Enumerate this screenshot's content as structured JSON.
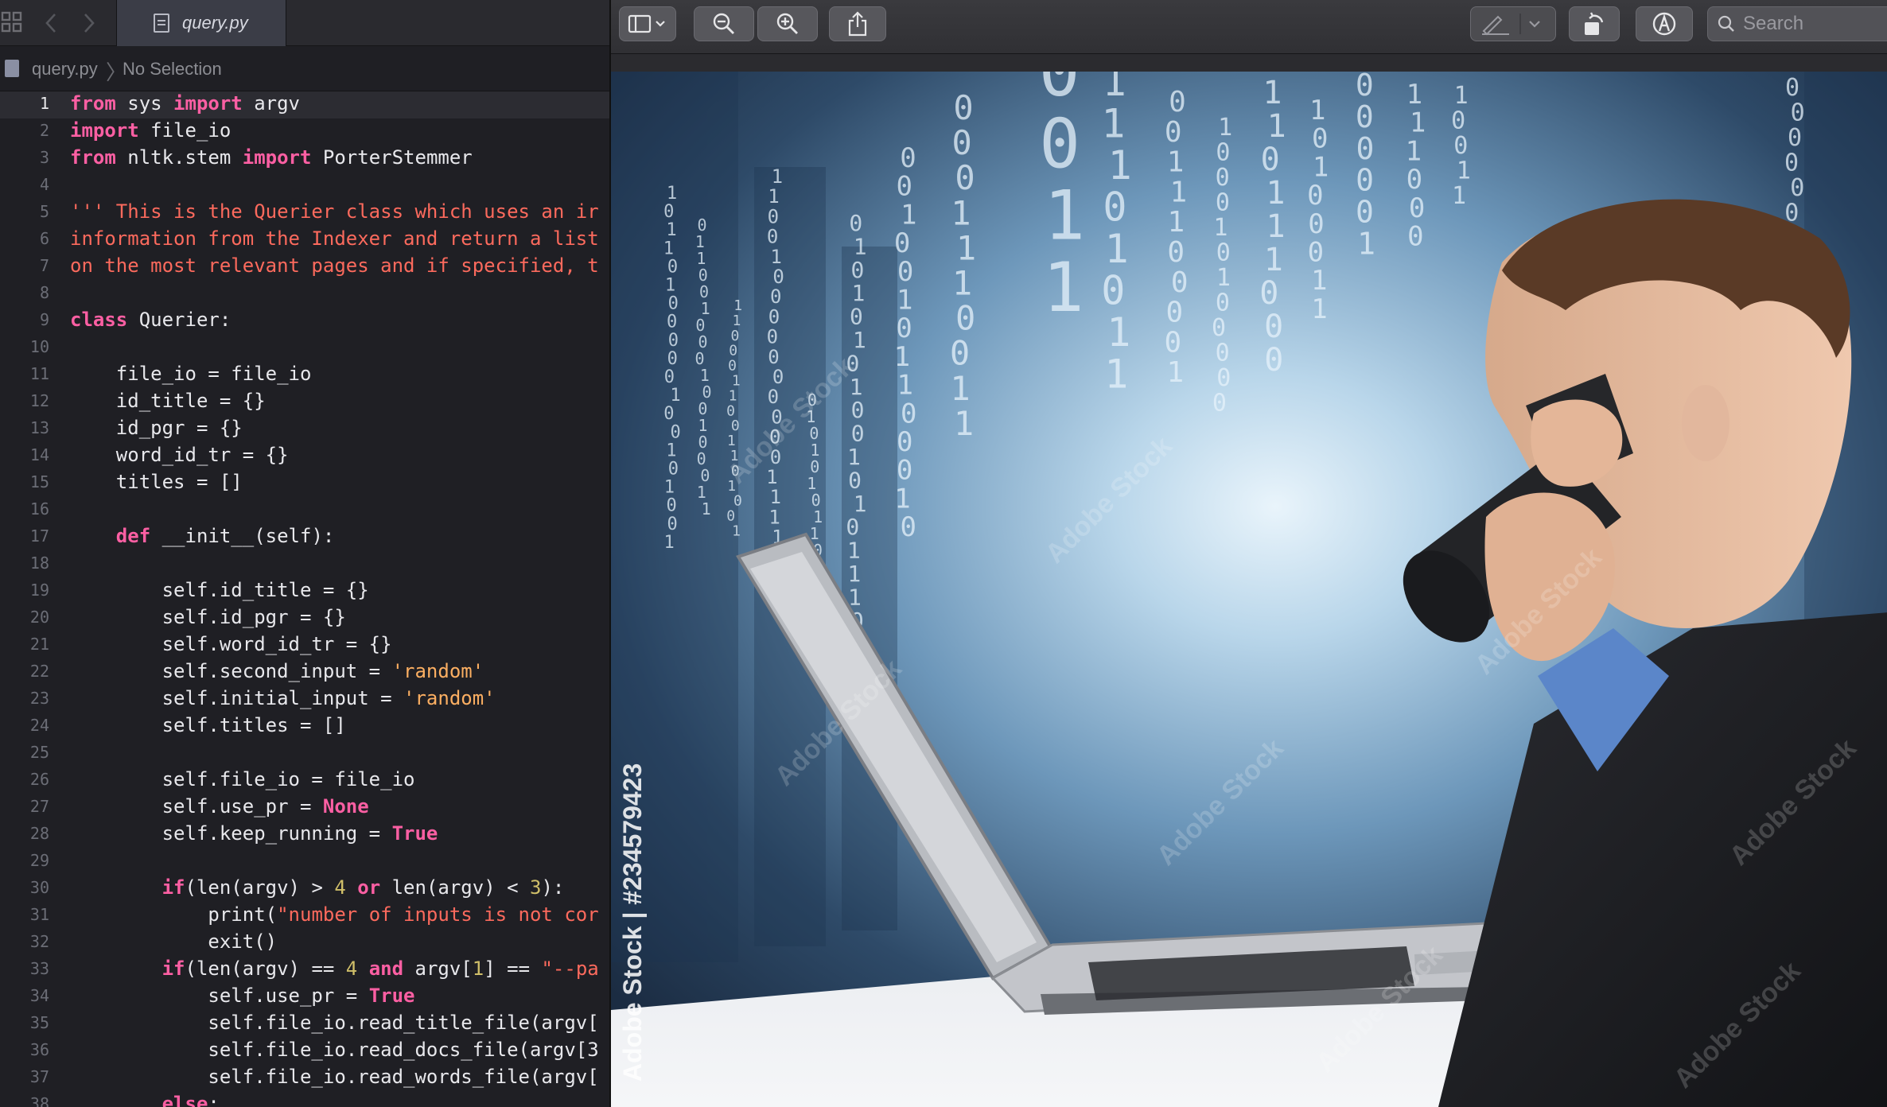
{
  "editor": {
    "tab_title": "query.py",
    "breadcrumb": {
      "file": "query.py",
      "selection": "No Selection"
    },
    "current_line": 1,
    "lines": [
      [
        {
          "t": "from",
          "c": "kw"
        },
        {
          "t": " sys "
        },
        {
          "t": "import",
          "c": "kw"
        },
        {
          "t": " argv"
        }
      ],
      [
        {
          "t": "import",
          "c": "kw"
        },
        {
          "t": " file_io"
        }
      ],
      [
        {
          "t": "from",
          "c": "kw"
        },
        {
          "t": " nltk.stem "
        },
        {
          "t": "import",
          "c": "kw"
        },
        {
          "t": " PorterStemmer"
        }
      ],
      [],
      [
        {
          "t": "''' This is the Querier class which uses an ir",
          "c": "cm"
        }
      ],
      [
        {
          "t": "information from the Indexer and return a list",
          "c": "cm"
        }
      ],
      [
        {
          "t": "on the most relevant pages and if specified, t",
          "c": "cm"
        }
      ],
      [],
      [
        {
          "t": "class",
          "c": "kw"
        },
        {
          "t": " Querier:"
        }
      ],
      [],
      [
        {
          "t": "    file_io = file_io"
        }
      ],
      [
        {
          "t": "    id_title = {}"
        }
      ],
      [
        {
          "t": "    id_pgr = {}"
        }
      ],
      [
        {
          "t": "    word_id_tr = {}"
        }
      ],
      [
        {
          "t": "    titles = []"
        }
      ],
      [],
      [
        {
          "t": "    "
        },
        {
          "t": "def",
          "c": "kw"
        },
        {
          "t": " __init__(self):"
        }
      ],
      [],
      [
        {
          "t": "        self.id_title = {}"
        }
      ],
      [
        {
          "t": "        self.id_pgr = {}"
        }
      ],
      [
        {
          "t": "        self.word_id_tr = {}"
        }
      ],
      [
        {
          "t": "        self.second_input = "
        },
        {
          "t": "'random'",
          "c": "sq"
        }
      ],
      [
        {
          "t": "        self.initial_input = "
        },
        {
          "t": "'random'",
          "c": "sq"
        }
      ],
      [
        {
          "t": "        self.titles = []"
        }
      ],
      [],
      [
        {
          "t": "        self.file_io = file_io"
        }
      ],
      [
        {
          "t": "        self.use_pr = "
        },
        {
          "t": "None",
          "c": "kw"
        }
      ],
      [
        {
          "t": "        self.keep_running = "
        },
        {
          "t": "True",
          "c": "kw"
        }
      ],
      [],
      [
        {
          "t": "        "
        },
        {
          "t": "if",
          "c": "kw"
        },
        {
          "t": "(len(argv) > "
        },
        {
          "t": "4",
          "c": "num"
        },
        {
          "t": " "
        },
        {
          "t": "or",
          "c": "kw"
        },
        {
          "t": " len(argv) < "
        },
        {
          "t": "3",
          "c": "num"
        },
        {
          "t": "):"
        }
      ],
      [
        {
          "t": "            print("
        },
        {
          "t": "\"number of inputs is not cor",
          "c": "str"
        }
      ],
      [
        {
          "t": "            exit()"
        }
      ],
      [
        {
          "t": "        "
        },
        {
          "t": "if",
          "c": "kw"
        },
        {
          "t": "(len(argv) == "
        },
        {
          "t": "4",
          "c": "num"
        },
        {
          "t": " "
        },
        {
          "t": "and",
          "c": "kw"
        },
        {
          "t": " argv["
        },
        {
          "t": "1",
          "c": "num"
        },
        {
          "t": "] == "
        },
        {
          "t": "\"--pa",
          "c": "str"
        }
      ],
      [
        {
          "t": "            self.use_pr = "
        },
        {
          "t": "True",
          "c": "kw"
        }
      ],
      [
        {
          "t": "            self.file_io.read_title_file(argv["
        }
      ],
      [
        {
          "t": "            self.file_io.read_docs_file(argv[3"
        }
      ],
      [
        {
          "t": "            self.file_io.read_words_file(argv["
        }
      ],
      [
        {
          "t": "        "
        },
        {
          "t": "else",
          "c": "kw"
        },
        {
          "t": ":"
        }
      ]
    ]
  },
  "preview": {
    "toolbar": {
      "sidebar_icon": "sidebar-toggle-icon",
      "zoom_out_icon": "zoom-out-icon",
      "zoom_in_icon": "zoom-in-icon",
      "share_icon": "share-icon",
      "markup_icon": "markup-pen-icon",
      "rotate_icon": "rotate-icon",
      "annotate_icon": "annotate-icon",
      "search_placeholder": "Search"
    },
    "image": {
      "watermark": "Adobe Stock | #234579423",
      "watermark_repeat": "Adobe Stock"
    }
  },
  "colors": {
    "keyword": "#fc5fa3",
    "string": "#fc6a5d",
    "number": "#d0bf69",
    "single_quote_string": "#fcaf62",
    "editor_bg": "#1f1f24"
  }
}
